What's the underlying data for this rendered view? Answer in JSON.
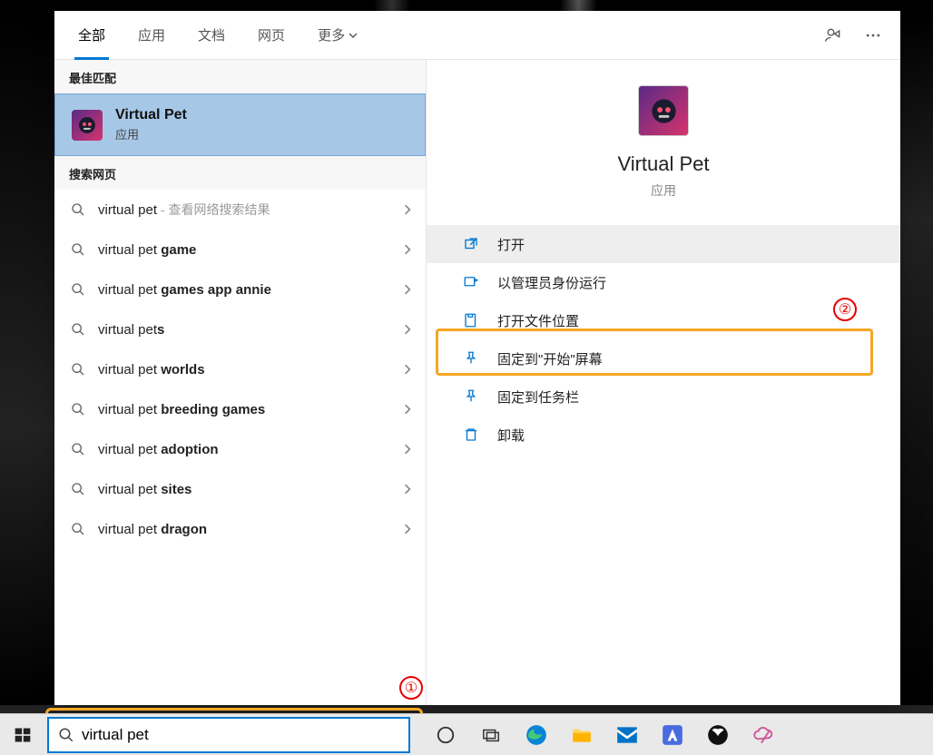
{
  "tabs": {
    "all": "全部",
    "apps": "应用",
    "docs": "文档",
    "web": "网页",
    "more": "更多"
  },
  "sections": {
    "best_match": "最佳匹配",
    "search_web": "搜索网页"
  },
  "best_match": {
    "title": "Virtual Pet",
    "subtitle": "应用"
  },
  "web_results": [
    {
      "prefix": "virtual pet",
      "bold": "",
      "hint": " - 查看网络搜索结果"
    },
    {
      "prefix": "virtual pet ",
      "bold": "game",
      "hint": ""
    },
    {
      "prefix": "virtual pet ",
      "bold": "games app annie",
      "hint": ""
    },
    {
      "prefix": "virtual pet",
      "bold": "s",
      "hint": ""
    },
    {
      "prefix": "virtual pet ",
      "bold": "worlds",
      "hint": ""
    },
    {
      "prefix": "virtual pet ",
      "bold": "breeding games",
      "hint": ""
    },
    {
      "prefix": "virtual pet ",
      "bold": "adoption",
      "hint": ""
    },
    {
      "prefix": "virtual pet ",
      "bold": "sites",
      "hint": ""
    },
    {
      "prefix": "virtual pet ",
      "bold": "dragon",
      "hint": ""
    }
  ],
  "detail": {
    "title": "Virtual Pet",
    "subtitle": "应用"
  },
  "actions": {
    "open": "打开",
    "run_admin": "以管理员身份运行",
    "open_location": "打开文件位置",
    "pin_start": "固定到\"开始\"屏幕",
    "pin_taskbar": "固定到任务栏",
    "uninstall": "卸载"
  },
  "annotations": {
    "one": "①",
    "two": "②"
  },
  "taskbar": {
    "search_value": "virtual pet"
  }
}
